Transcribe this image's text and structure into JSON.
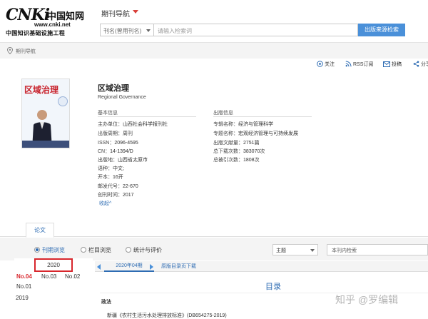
{
  "logo": {
    "brand": "CNKi",
    "brand_cn": "中国知网",
    "url": "www.cnki.net",
    "slogan": "中国知识基础设施工程"
  },
  "header": {
    "nav_title": "期刊导航",
    "search_field": "刊名(曾用刊名)",
    "search_placeholder": "请输入检索词",
    "search_button": "出版来源检索"
  },
  "breadcrumb": {
    "text": "期刊导航"
  },
  "actions": [
    {
      "label": "关注",
      "icon": "follow-icon"
    },
    {
      "label": "RSS订阅",
      "icon": "rss-icon"
    },
    {
      "label": "投稿",
      "icon": "mail-icon"
    },
    {
      "label": "分享",
      "icon": "share-icon"
    }
  ],
  "journal": {
    "cover_title": "区域治理",
    "title": "区域治理",
    "title_en": "Regional Governance",
    "basic_heading": "基本信息",
    "publish_heading": "出版信息",
    "basic": [
      {
        "label": "主办单位：",
        "value": "山西社会科学报刊社"
      },
      {
        "label": "出版周期：",
        "value": "周刊"
      },
      {
        "label": "ISSN：",
        "value": "2096-4595"
      },
      {
        "label": "CN：",
        "value": "14-1394/D"
      },
      {
        "label": "出版地：",
        "value": "山西省太原市"
      },
      {
        "label": "语种：",
        "value": "中文;"
      },
      {
        "label": "开本：",
        "value": "16开"
      },
      {
        "label": "邮发代号：",
        "value": "22-670"
      },
      {
        "label": "创刊时间：",
        "value": "2017"
      }
    ],
    "publish": [
      {
        "label": "专辑名称：",
        "value": "经济与管理科学"
      },
      {
        "label": "专题名称：",
        "value": "宏观经济管理与可持续发展"
      },
      {
        "label": "出版文献量：",
        "value": "2751篇"
      },
      {
        "label": "总下载次数：",
        "value": "383070次"
      },
      {
        "label": "总被引次数：",
        "value": "1808次"
      }
    ],
    "collapse": "收起^"
  },
  "tabs": {
    "paper": "论文"
  },
  "filters": {
    "options": [
      "刊期浏览",
      "栏目浏览",
      "统计与评价"
    ],
    "selected_index": 0,
    "subject_select": "主题",
    "search_placeholder": "本刊内检索"
  },
  "years": {
    "current_year": "2020",
    "issues": [
      "No.04",
      "No.03",
      "No.02",
      "No.01"
    ],
    "active_issue": "No.04",
    "prev_year": "2019"
  },
  "content": {
    "issue_tab": "2020年04期",
    "original_toc": "原版目录页下载",
    "toc_title": "目录",
    "section": "政法",
    "first_item": "新疆《农村生活污水处理排放标准》(DB654275-2019)"
  },
  "watermark": "知乎 @罗编辑",
  "colors": {
    "link_blue": "#2e6cb3",
    "button_blue": "#4a90d9",
    "active_red": "#d8262c",
    "nav_caret_red": "#d9413b"
  }
}
